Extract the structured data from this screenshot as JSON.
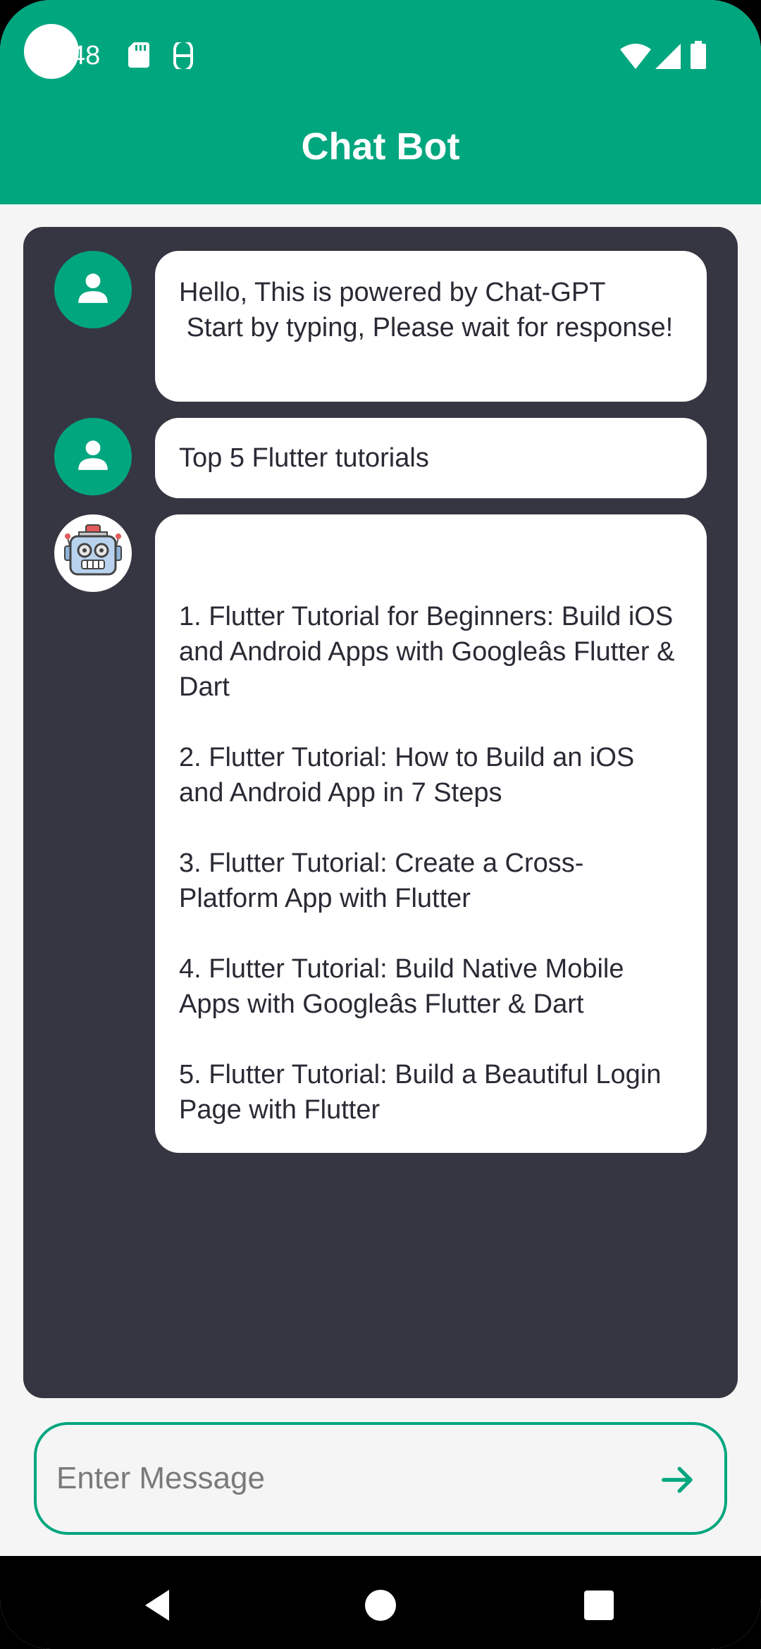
{
  "status_bar": {
    "time": "48"
  },
  "app_bar": {
    "title": "Chat Bot"
  },
  "messages": [
    {
      "sender": "user",
      "text": "Hello, This is powered by Chat-GPT\n Start by typing, Please wait for response!"
    },
    {
      "sender": "user",
      "text": "Top 5 Flutter tutorials"
    },
    {
      "sender": "bot",
      "text": "\n\n1. Flutter Tutorial for Beginners: Build iOS and Android Apps with Googleâs Flutter & Dart\n\n2. Flutter Tutorial: How to Build an iOS and Android App in 7 Steps\n\n3. Flutter Tutorial: Create a Cross-Platform App with Flutter\n\n4. Flutter Tutorial: Build Native Mobile Apps with Googleâs Flutter & Dart\n\n5. Flutter Tutorial: Build a Beautiful Login Page with Flutter"
    }
  ],
  "input": {
    "placeholder": "Enter Message",
    "value": ""
  },
  "icons": {
    "user_avatar": "person-icon",
    "bot_avatar": "robot-icon",
    "send": "arrow-right-icon",
    "nav_back": "triangle-back-icon",
    "nav_home": "circle-home-icon",
    "nav_recents": "square-recents-icon"
  },
  "colors": {
    "brand": "#00a67e",
    "chat_panel": "#363642",
    "bubble": "#ffffff",
    "text": "#2a2a35"
  }
}
